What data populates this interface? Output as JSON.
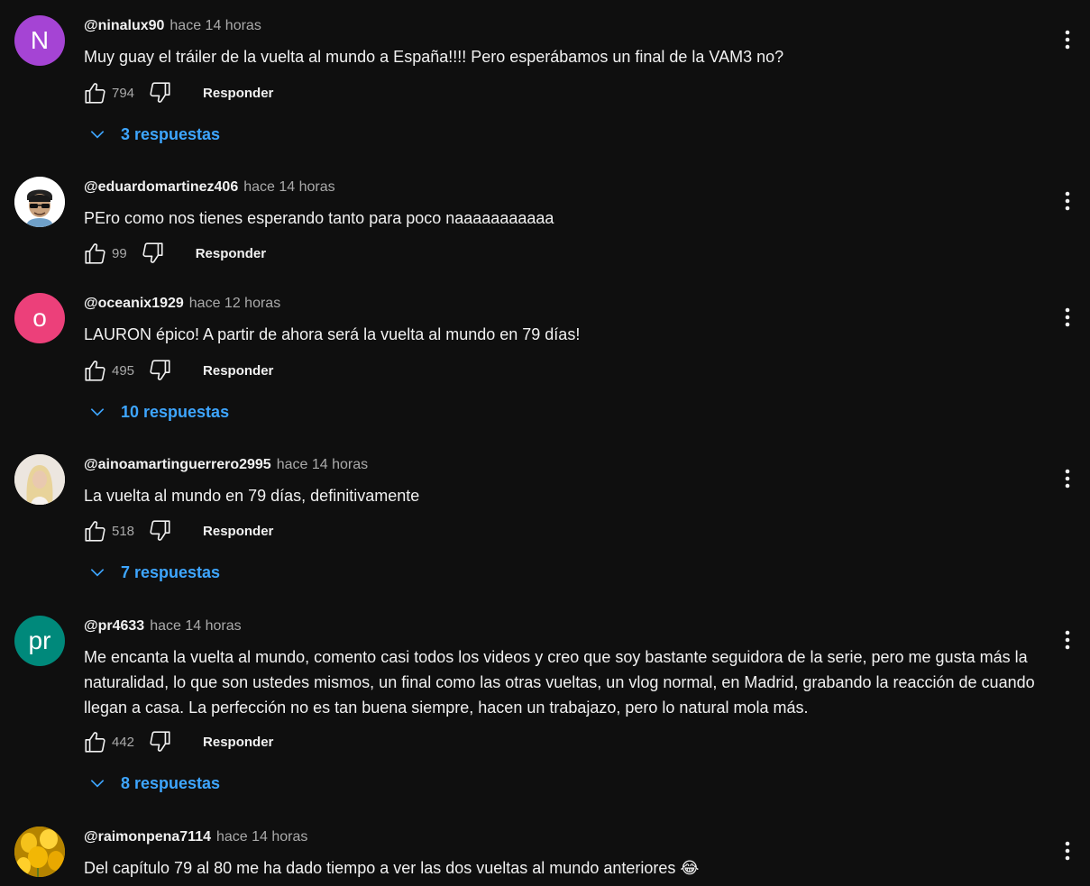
{
  "icons": {
    "like": "thumb-up-icon",
    "dislike": "thumb-down-icon",
    "expand": "chevron-down-icon",
    "menu": "more-vertical-icon"
  },
  "colors": {
    "background": "#0f0f0f",
    "link": "#3ea6ff",
    "muted": "#aaaaaa"
  },
  "comments": [
    {
      "author": "@ninalux90",
      "time": "hace 14 horas",
      "avatar_letter": "N",
      "avatar_color": "#a544d4",
      "text": "Muy guay el tráiler de la vuelta al mundo a España!!!! Pero esperábamos un final de la VAM3 no?",
      "likes": "794",
      "reply_label": "Responder",
      "replies": "3 respuestas"
    },
    {
      "author": "@eduardomartinez406",
      "time": "hace 14 horas",
      "avatar_letter": "",
      "avatar_color": "#ffffff",
      "text": "PEro como nos tienes esperando tanto para poco naaaaaaaaaaa",
      "likes": "99",
      "reply_label": "Responder",
      "replies": ""
    },
    {
      "author": "@oceanix1929",
      "time": "hace 12 horas",
      "avatar_letter": "o",
      "avatar_color": "#ec407a",
      "text": "LAURON épico! A partir de ahora será la vuelta al mundo en 79 días!",
      "likes": "495",
      "reply_label": "Responder",
      "replies": "10 respuestas"
    },
    {
      "author": "@ainoamartinguerrero2995",
      "time": "hace 14 horas",
      "avatar_letter": "",
      "avatar_color": "#e9e3dc",
      "text": "La vuelta al mundo en 79 días, definitivamente",
      "likes": "518",
      "reply_label": "Responder",
      "replies": "7 respuestas"
    },
    {
      "author": "@pr4633",
      "time": "hace 14 horas",
      "avatar_letter": "pr",
      "avatar_color": "#00897b",
      "text": "Me encanta la vuelta al mundo, comento casi todos los videos y creo que soy bastante seguidora de la serie, pero me gusta más la naturalidad, lo que son ustedes mismos, un final como las otras vueltas, un vlog normal, en Madrid, grabando la reacción de cuando llegan a casa. La perfección no es tan buena siempre, hacen un trabajazo, pero lo natural mola más.",
      "likes": "442",
      "reply_label": "Responder",
      "replies": "8 respuestas"
    },
    {
      "author": "@raimonpena7114",
      "time": "hace 14 horas",
      "avatar_letter": "",
      "avatar_color": "#d9a400",
      "text": "Del capítulo 79 al 80 me ha dado tiempo a ver las dos vueltas al mundo anteriores 😂",
      "likes": "",
      "reply_label": "",
      "replies": ""
    }
  ]
}
